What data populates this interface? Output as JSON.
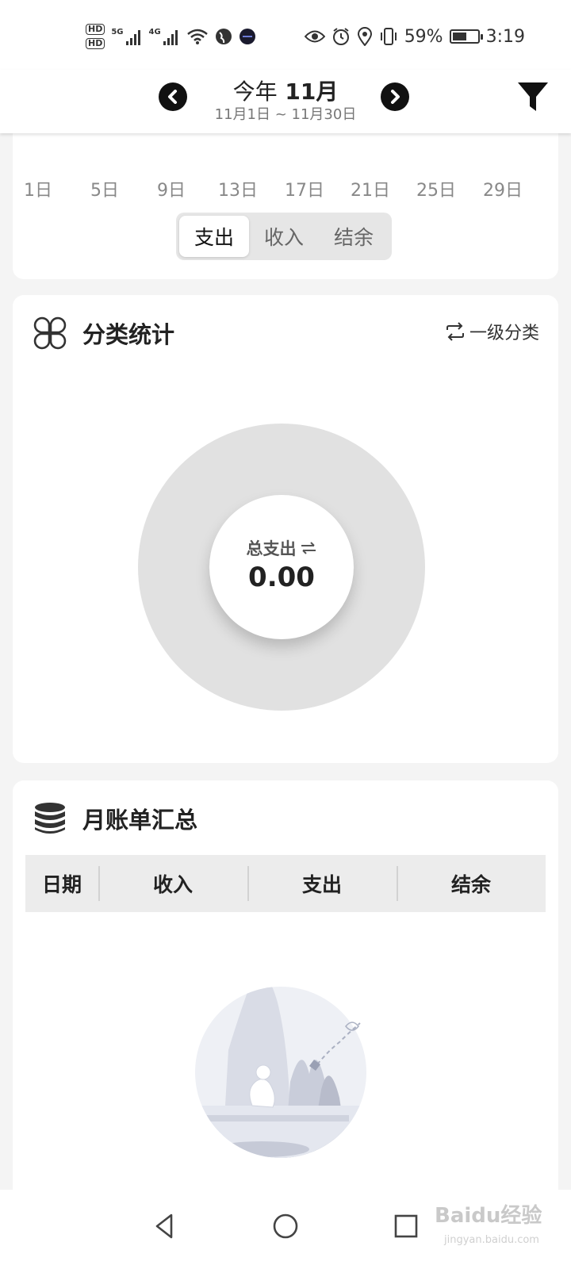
{
  "status_bar": {
    "sim1": "HD",
    "sim2": "HD",
    "net1": "5G",
    "net2": "4G",
    "battery_percent": "59%",
    "battery_level": 0.59,
    "time": "3:19",
    "icons": [
      "eye-icon",
      "alarm-icon",
      "location-icon",
      "vibrate-icon"
    ]
  },
  "header": {
    "period_prefix": "今年",
    "period_month": "11月",
    "period_range": "11月1日 ~ 11月30日",
    "prev_icon": "chevron-left-circle-icon",
    "next_icon": "chevron-right-circle-icon",
    "filter_icon": "filter-icon"
  },
  "trend": {
    "days": [
      "1日",
      "5日",
      "9日",
      "13日",
      "17日",
      "21日",
      "25日",
      "29日"
    ],
    "tabs": [
      "支出",
      "收入",
      "结余"
    ],
    "active_tab": "支出"
  },
  "category": {
    "title": "分类统计",
    "icon": "four-petal-grid-icon",
    "level_label": "一级分类",
    "total_label": "总支出",
    "total_value": "0.00"
  },
  "monthly": {
    "title": "月账单汇总",
    "icon": "database-icon",
    "columns": [
      "日期",
      "收入",
      "支出",
      "结余"
    ],
    "rows": []
  },
  "watermark": {
    "brand": "Baidu经验",
    "site": "jingyan.baidu.com"
  },
  "colors": {
    "accent": "#111111",
    "donut_track": "#e1e1e1",
    "page_bg": "#f4f4f4"
  }
}
